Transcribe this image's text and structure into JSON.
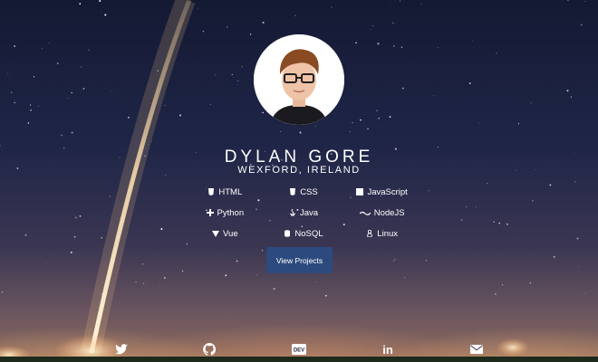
{
  "profile": {
    "name": "DYLAN GORE",
    "location": "WEXFORD, IRELAND"
  },
  "skills": [
    {
      "label": "HTML",
      "icon": "html5-icon"
    },
    {
      "label": "CSS",
      "icon": "css3-icon"
    },
    {
      "label": "JavaScript",
      "icon": "javascript-icon"
    },
    {
      "label": "Python",
      "icon": "python-icon"
    },
    {
      "label": "Java",
      "icon": "java-icon"
    },
    {
      "label": "NodeJS",
      "icon": "nodejs-icon"
    },
    {
      "label": "Vue",
      "icon": "vue-icon"
    },
    {
      "label": "NoSQL",
      "icon": "database-icon"
    },
    {
      "label": "Linux",
      "icon": "linux-icon"
    }
  ],
  "cta": {
    "label": "View Projects"
  },
  "social": [
    {
      "icon": "twitter-icon"
    },
    {
      "icon": "github-icon"
    },
    {
      "icon": "dev-icon",
      "label": "DEV"
    },
    {
      "icon": "linkedin-icon",
      "label": "in"
    },
    {
      "icon": "email-icon"
    }
  ],
  "colors": {
    "button": "#2c4a7e",
    "text": "#ffffff"
  }
}
